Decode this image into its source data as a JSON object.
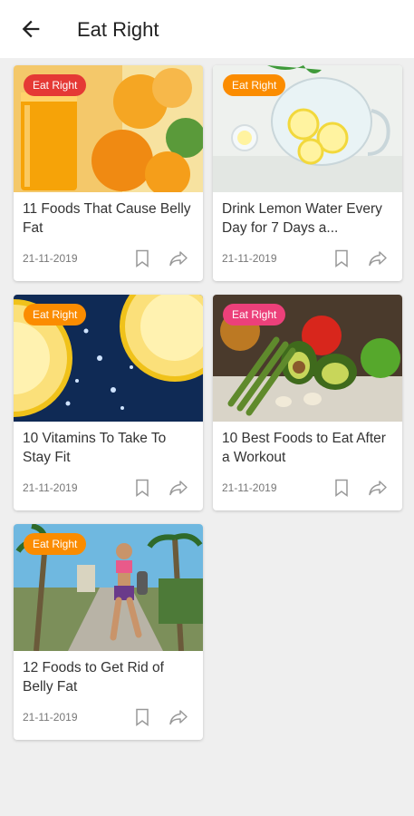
{
  "header": {
    "title": "Eat Right",
    "back_icon": "arrow-left-icon"
  },
  "colors": {
    "badge_red": "#e53935",
    "badge_orange": "#fb8c00",
    "badge_pink": "#ec407a",
    "background": "#efefef"
  },
  "articles": [
    {
      "badge": "Eat Right",
      "title": "11 Foods That Cause Belly Fat",
      "date": "21-11-2019",
      "image": "orange-juice-image"
    },
    {
      "badge": "Eat Right",
      "title": "Drink Lemon Water Every Day for 7 Days a...",
      "date": "21-11-2019",
      "image": "lemon-water-image"
    },
    {
      "badge": "Eat Right",
      "title": "10 Vitamins To Take To Stay Fit",
      "date": "21-11-2019",
      "image": "lemon-slices-image"
    },
    {
      "badge": "Eat Right",
      "title": "10 Best Foods to Eat After a Workout",
      "date": "21-11-2019",
      "image": "vegetables-image"
    },
    {
      "badge": "Eat Right",
      "title": "12 Foods to Get Rid of Belly Fat",
      "date": "21-11-2019",
      "image": "woman-running-image"
    }
  ]
}
